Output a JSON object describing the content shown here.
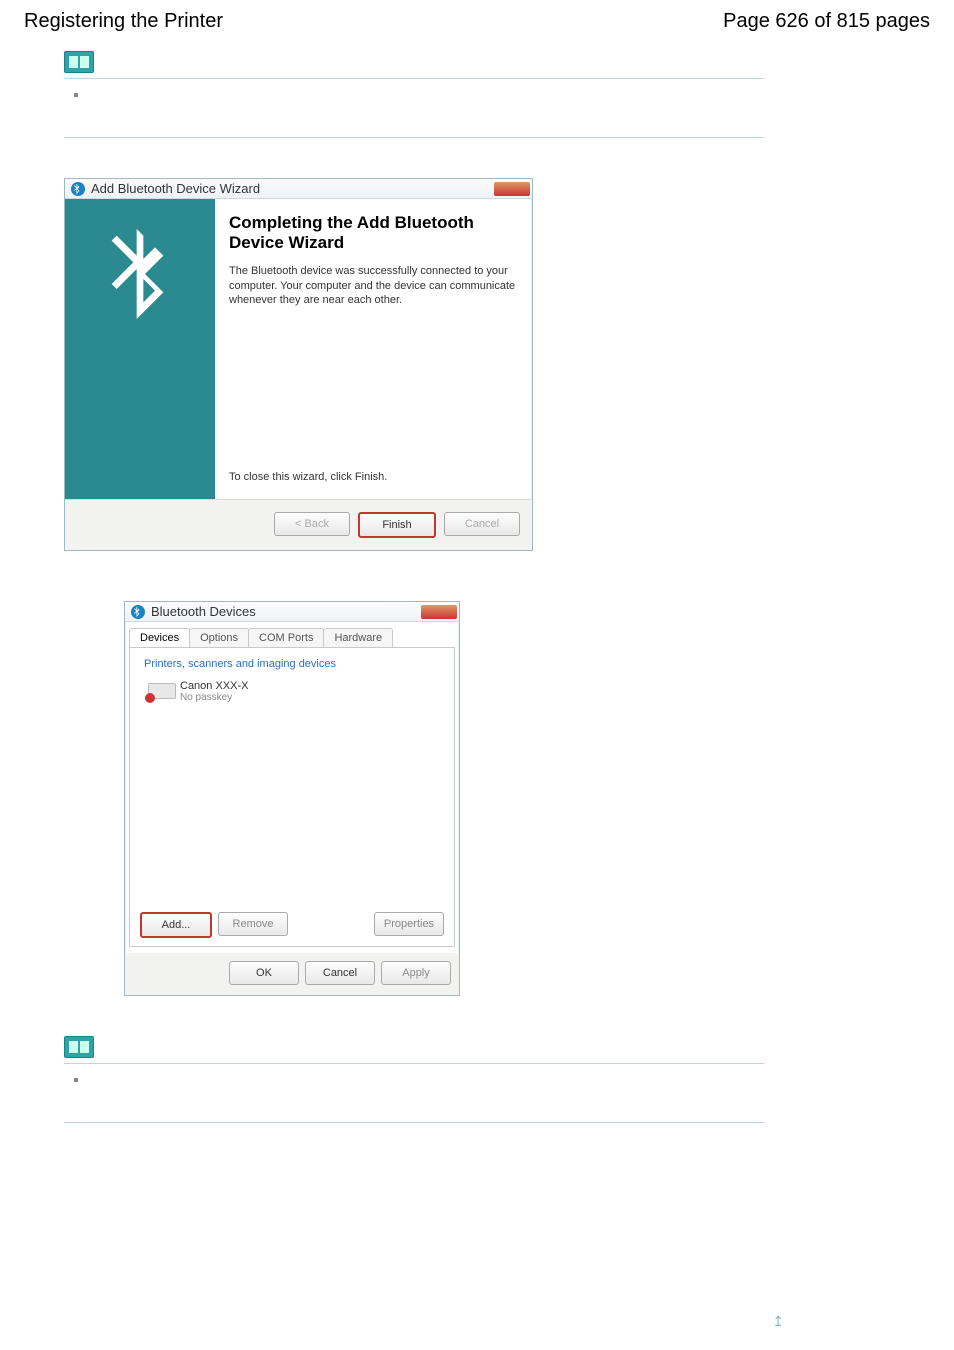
{
  "header": {
    "title": "Registering the Printer",
    "pagination": "Page 626 of 815 pages"
  },
  "wizard": {
    "title": "Add Bluetooth Device Wizard",
    "heading": "Completing the Add Bluetooth Device Wizard",
    "para1": "The Bluetooth device was successfully connected to your computer. Your computer and the device can communicate whenever they are near each other.",
    "close_hint": "To close this wizard, click Finish.",
    "back": "< Back",
    "finish": "Finish",
    "cancel": "Cancel"
  },
  "devices_dialog": {
    "title": "Bluetooth Devices",
    "tabs": {
      "devices": "Devices",
      "options": "Options",
      "com": "COM Ports",
      "hardware": "Hardware"
    },
    "group_label": "Printers, scanners and imaging devices",
    "device": {
      "name": "Canon XXX-X",
      "sub": "No passkey"
    },
    "buttons": {
      "add": "Add...",
      "remove": "Remove",
      "properties": "Properties",
      "ok": "OK",
      "cancel": "Cancel",
      "apply": "Apply"
    }
  },
  "pagetop_glyph": "↥"
}
